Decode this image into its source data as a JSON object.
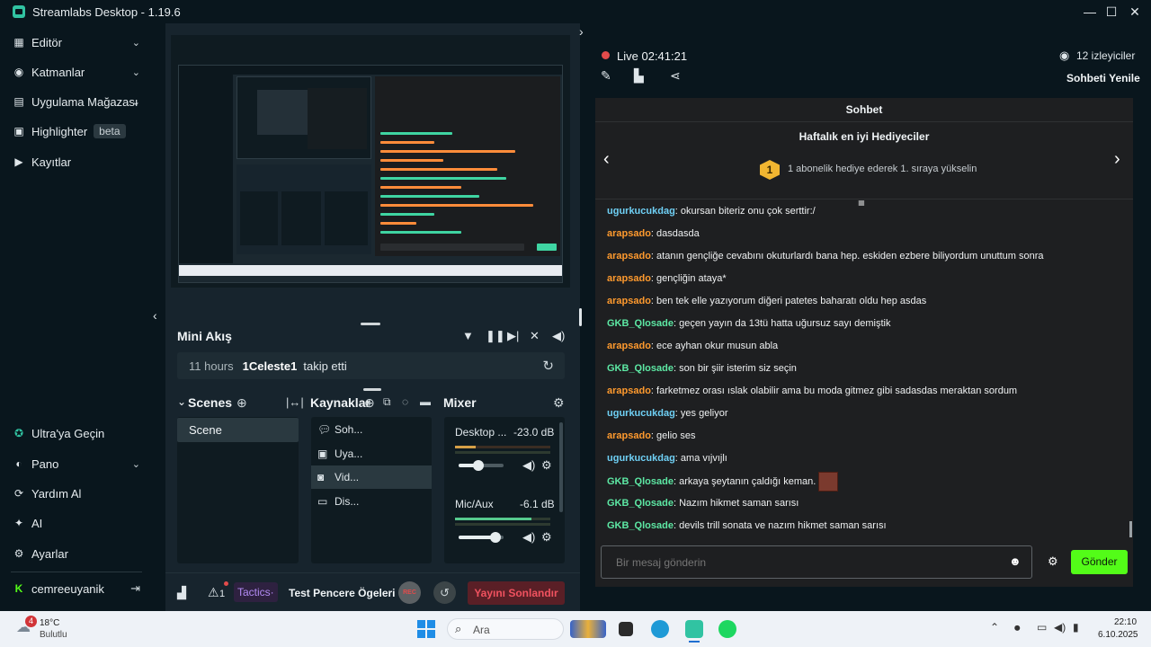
{
  "window": {
    "title": "Streamlabs Desktop - 1.19.6"
  },
  "nav": {
    "top": [
      {
        "label": "Editör",
        "icon": "editor-icon"
      },
      {
        "label": "Katmanlar",
        "icon": "layers-icon"
      },
      {
        "label": "Uygulama Mağazası",
        "icon": "store-icon"
      },
      {
        "label": "Highlighter",
        "icon": "highlighter-icon",
        "badge": "beta"
      },
      {
        "label": "Kayıtlar",
        "icon": "recordings-icon"
      }
    ],
    "bottom": [
      {
        "label": "Ultra'ya Geçin",
        "icon": "ultra-icon"
      },
      {
        "label": "Pano",
        "icon": "dashboard-icon"
      },
      {
        "label": "Yardım Al",
        "icon": "help-icon"
      },
      {
        "label": "AI",
        "icon": "ai-icon"
      },
      {
        "label": "Ayarlar",
        "icon": "settings-icon"
      },
      {
        "label": "cemreeuyanik",
        "icon": "kick-icon"
      }
    ]
  },
  "mini_feed": {
    "title": "Mini Akış",
    "event_time": "11 hours",
    "event_user": "1Celeste1",
    "event_action": "takip etti"
  },
  "docks": {
    "scenes_title": "Scenes",
    "sources_title": "Kaynaklar",
    "mixer_title": "Mixer",
    "scenes": [
      "Scene"
    ],
    "sources": [
      {
        "label": "Soh...",
        "icon": "chat-icon"
      },
      {
        "label": "Uya...",
        "icon": "alert-icon"
      },
      {
        "label": "Vid...",
        "icon": "video-icon",
        "selected": true
      },
      {
        "label": "Dis...",
        "icon": "display-icon"
      }
    ],
    "mixer": [
      {
        "name": "Desktop ...",
        "db": "-23.0 dB",
        "level": 0.22
      },
      {
        "name": "Mic/Aux",
        "db": "-6.1 dB",
        "level": 0.8
      }
    ]
  },
  "bottom_bar": {
    "alerts_count": "1",
    "tactics": "Tactics·",
    "test_windows": "Test Pencere Ögeleri",
    "rec_label": "REC",
    "end_stream": "Yayını Sonlandır"
  },
  "chat": {
    "live_label": "Live",
    "live_time": "02:41:21",
    "viewers": "12 izleyiciler",
    "refresh": "Sohbeti Yenile",
    "header": "Sohbet",
    "gifters_title": "Haftalık en iyi Hediyeciler",
    "gifters_badge": "1",
    "gifters_sub": "1 abonelik hediye ederek 1. sıraya yükselin",
    "placeholder": "Bir mesaj gönderin",
    "send": "Gönder",
    "messages": [
      {
        "user": "ugurkucukdag",
        "color": "#6fd0f5",
        "text": ": okursan biteriz onu çok serttir:/"
      },
      {
        "user": "arapsado",
        "color": "#ff9a2e",
        "text": ": dasdasda"
      },
      {
        "user": "arapsado",
        "color": "#ff9a2e",
        "text": ": atanın gençliğe cevabını okuturlardı bana hep. eskiden ezbere biliyordum unuttum sonra"
      },
      {
        "user": "arapsado",
        "color": "#ff9a2e",
        "text": ": gençliğin ataya*"
      },
      {
        "user": "arapsado",
        "color": "#ff9a2e",
        "text": ": ben tek elle yazıyorum diğeri patetes baharatı oldu hep asdas"
      },
      {
        "user": "GKB_Qlosade",
        "color": "#5de8a4",
        "text": ": geçen yayın da 13tü hatta uğursuz sayı demiştik"
      },
      {
        "user": "arapsado",
        "color": "#ff9a2e",
        "text": ": ece ayhan okur musun abla"
      },
      {
        "user": "GKB_Qlosade",
        "color": "#5de8a4",
        "text": ": son bir şiir isterim siz seçin"
      },
      {
        "user": "arapsado",
        "color": "#ff9a2e",
        "text": ": farketmez orası ıslak olabilir ama bu moda gitmez gibi sadasdas meraktan sordum"
      },
      {
        "user": "ugurkucukdag",
        "color": "#6fd0f5",
        "text": ": yes geliyor"
      },
      {
        "user": "arapsado",
        "color": "#ff9a2e",
        "text": ": gelio ses"
      },
      {
        "user": "ugurkucukdag",
        "color": "#6fd0f5",
        "text": ": ama vıjvıjlı"
      },
      {
        "user": "GKB_Qlosade",
        "color": "#5de8a4",
        "text": ": arkaya şeytanın çaldığı keman.",
        "emote": true
      },
      {
        "user": "GKB_Qlosade",
        "color": "#5de8a4",
        "text": ": Nazım hikmet saman sarısı"
      },
      {
        "user": "GKB_Qlosade",
        "color": "#5de8a4",
        "text": ": devils trill sonata ve nazım hikmet saman sarısı"
      }
    ]
  },
  "taskbar": {
    "temp": "18°C",
    "weather": "Bulutlu",
    "weather_badge": "4",
    "search": "Ara",
    "time": "22:10",
    "date": "6.10.2025"
  }
}
